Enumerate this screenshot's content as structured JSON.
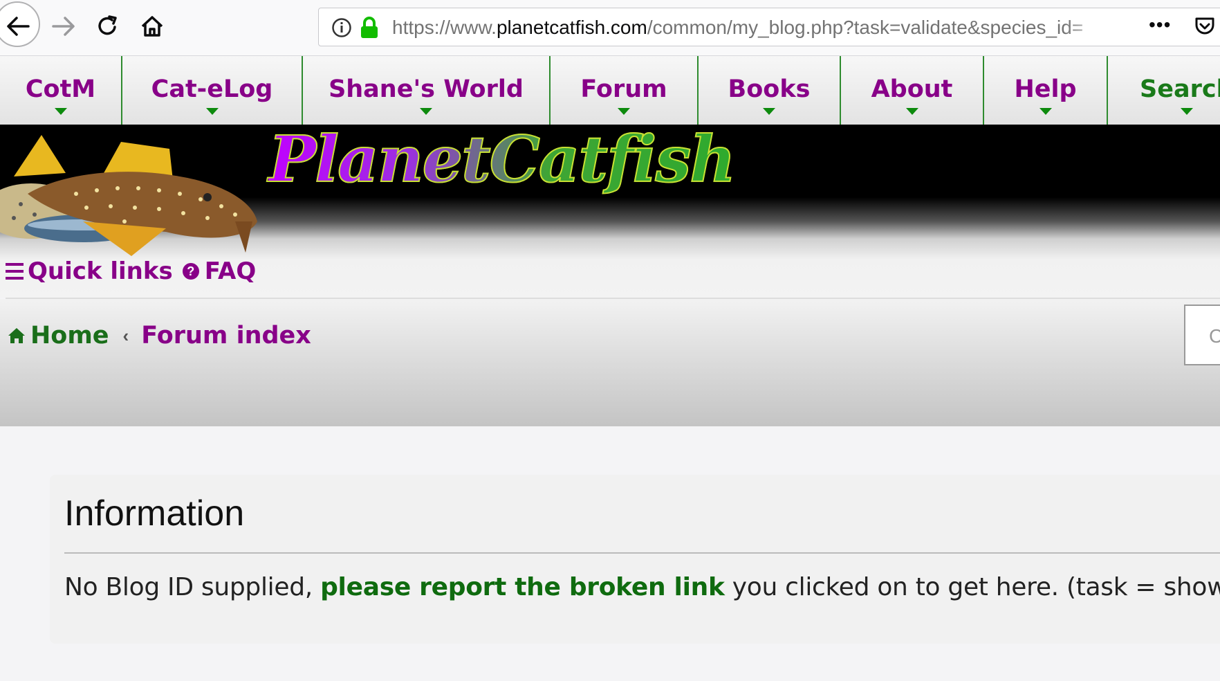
{
  "browser": {
    "url_prefix": "https://www.",
    "url_host": "planetcatfish.com",
    "url_path": "/common/my_blog.php?task=validate&species_id=",
    "menu_glyph": "•••"
  },
  "nav": {
    "items": [
      {
        "label": "CotM"
      },
      {
        "label": "Cat-eLog"
      },
      {
        "label": "Shane's World"
      },
      {
        "label": "Forum"
      },
      {
        "label": "Books"
      },
      {
        "label": "About"
      },
      {
        "label": "Help"
      },
      {
        "label": "Search"
      }
    ]
  },
  "banner": {
    "logo_text": "PlanetCatfish"
  },
  "quicklinks": {
    "label": "Quick links",
    "faq": "FAQ",
    "faq_glyph": "?"
  },
  "breadcrumb": {
    "home": "Home",
    "separator": "‹",
    "forum_index": "Forum index"
  },
  "search": {
    "placeholder_glyph": "C"
  },
  "info": {
    "title": "Information",
    "msg_before": "No Blog ID supplied, ",
    "msg_link": "please report the broken link",
    "msg_after": " you clicked on to get here. (task = show)"
  },
  "colors": {
    "accent_purple": "#880088",
    "accent_green": "#1a7a1a"
  }
}
